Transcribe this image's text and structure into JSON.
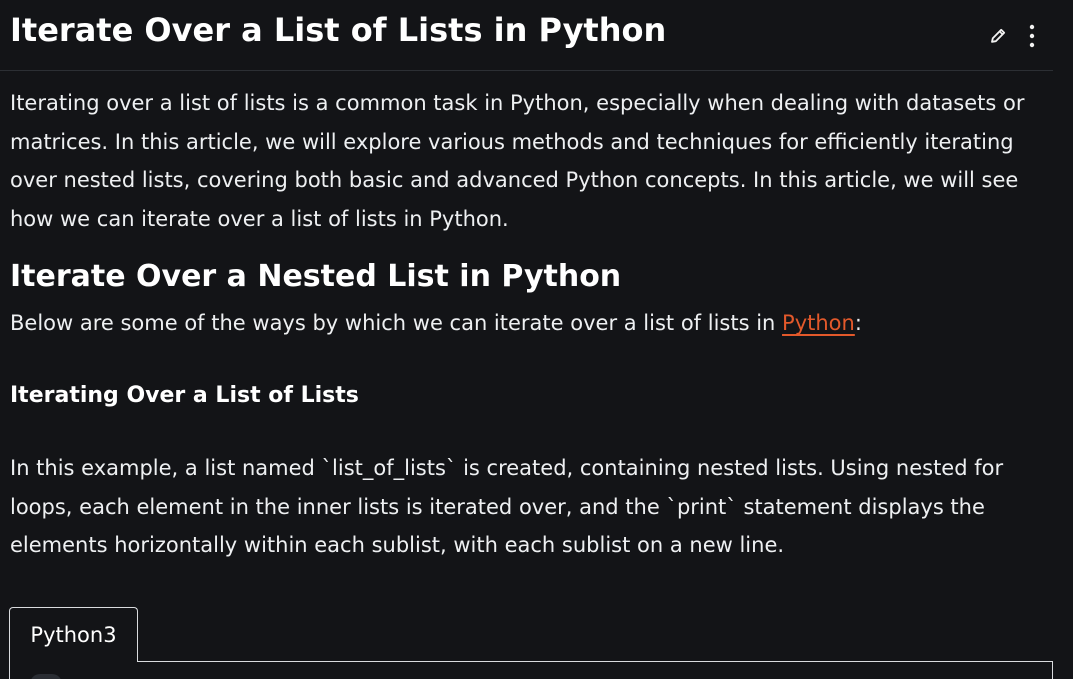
{
  "article": {
    "title": "Iterate Over a List of Lists in Python",
    "intro": "Iterating over a list of lists is a common task in Python, especially when dealing with datasets or matrices. In this article, we will explore various methods and techniques for efficiently iterating over nested lists, covering both basic and advanced Python concepts. In this article, we will see how we can iterate over a list of lists in Python.",
    "section_heading": "Iterate Over a Nested List in Python",
    "section_intro_before": "Below are some of the ways by which we can iterate over a list of lists in ",
    "section_intro_link": "Python",
    "section_intro_after": ":",
    "subheading": "Iterating Over a List of Lists",
    "example_text": "In this example, a list named `list_of_lists` is created, containing nested lists. Using nested for loops, each element in the inner lists is iterated over, and the `print` statement displays the elements horizontally within each sublist, with each sublist on a new line."
  },
  "toolbar": {
    "edit_icon": "pencil-icon",
    "more_icon": "vertical-dots-icon"
  },
  "code": {
    "tab_label": "Python3"
  },
  "colors": {
    "background": "#131417",
    "text": "#eef0f2",
    "link": "#e3592b",
    "border": "#d9dbde"
  }
}
